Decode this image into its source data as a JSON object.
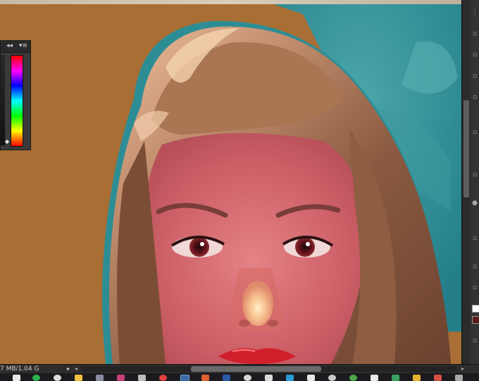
{
  "status_bar": {
    "doc_size": "7 MB/1.04 G",
    "scroll_right_arrow": "▸",
    "scroll_left_arrow": "◂",
    "scroll_end_arrow": "▸"
  },
  "color_panel": {
    "collapse_glyph": "◂◂",
    "menu_glyph": "▾≡",
    "marker_glyph": "◆"
  },
  "icons": [
    "collapse-icon",
    "panel-menu-icon",
    "color-spectrum",
    "taskbar-app-icons"
  ],
  "colors": {
    "canvas_background": "#a86e34",
    "sky": "#2f8e96",
    "skin": "#d56a6e",
    "hair": "#9b6a4c",
    "lips": "#d0202c"
  }
}
